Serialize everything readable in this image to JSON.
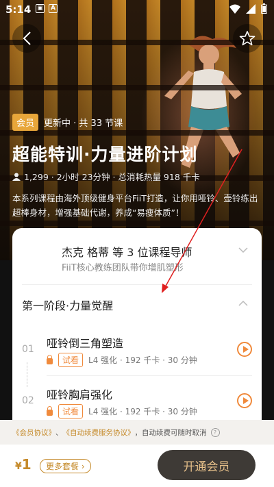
{
  "status_bar": {
    "time": "5:14"
  },
  "header": {
    "back_icon": "chevron-left-icon",
    "favorite_icon": "star-icon"
  },
  "course": {
    "badge": "会员",
    "update_status": "更新中 · 共 33 节课",
    "title": "超能特训·力量进阶计划",
    "meta": "1,299 · 2小时 23分钟 · 总消耗热量 918 千卡",
    "description": "本系列课程由海外顶级健身平台FiiT打造，让你用哑铃、壶铃练出超棒身材，增强基础代谢，养成“易瘦体质”！"
  },
  "coach": {
    "name": "杰克 格蒂 等 3 位课程导师",
    "subtitle": "FiiT核心教练团队带你增肌塑形"
  },
  "stage": {
    "title": "第一阶段·力量觉醒"
  },
  "lessons": [
    {
      "num": "01",
      "title": "哑铃倒三角塑造",
      "trial": "试看",
      "meta": "L4 强化 · 192 千卡 · 30 分钟"
    },
    {
      "num": "02",
      "title": "哑铃胸肩强化",
      "trial": "试看",
      "meta": "L4 强化 · 192 千卡 · 30 分钟"
    }
  ],
  "agreement": {
    "member": "《会员协议》",
    "sep": "、",
    "auto": "《自动续费服务协议》",
    "note": "，自动续费可随时取消"
  },
  "footer": {
    "currency": "¥",
    "price": "1",
    "more_label": "更多套餐",
    "open_label": "开通会员"
  },
  "colors": {
    "accent": "#f08a3c",
    "gold": "#c58a2a",
    "annotation": "#e02020"
  }
}
